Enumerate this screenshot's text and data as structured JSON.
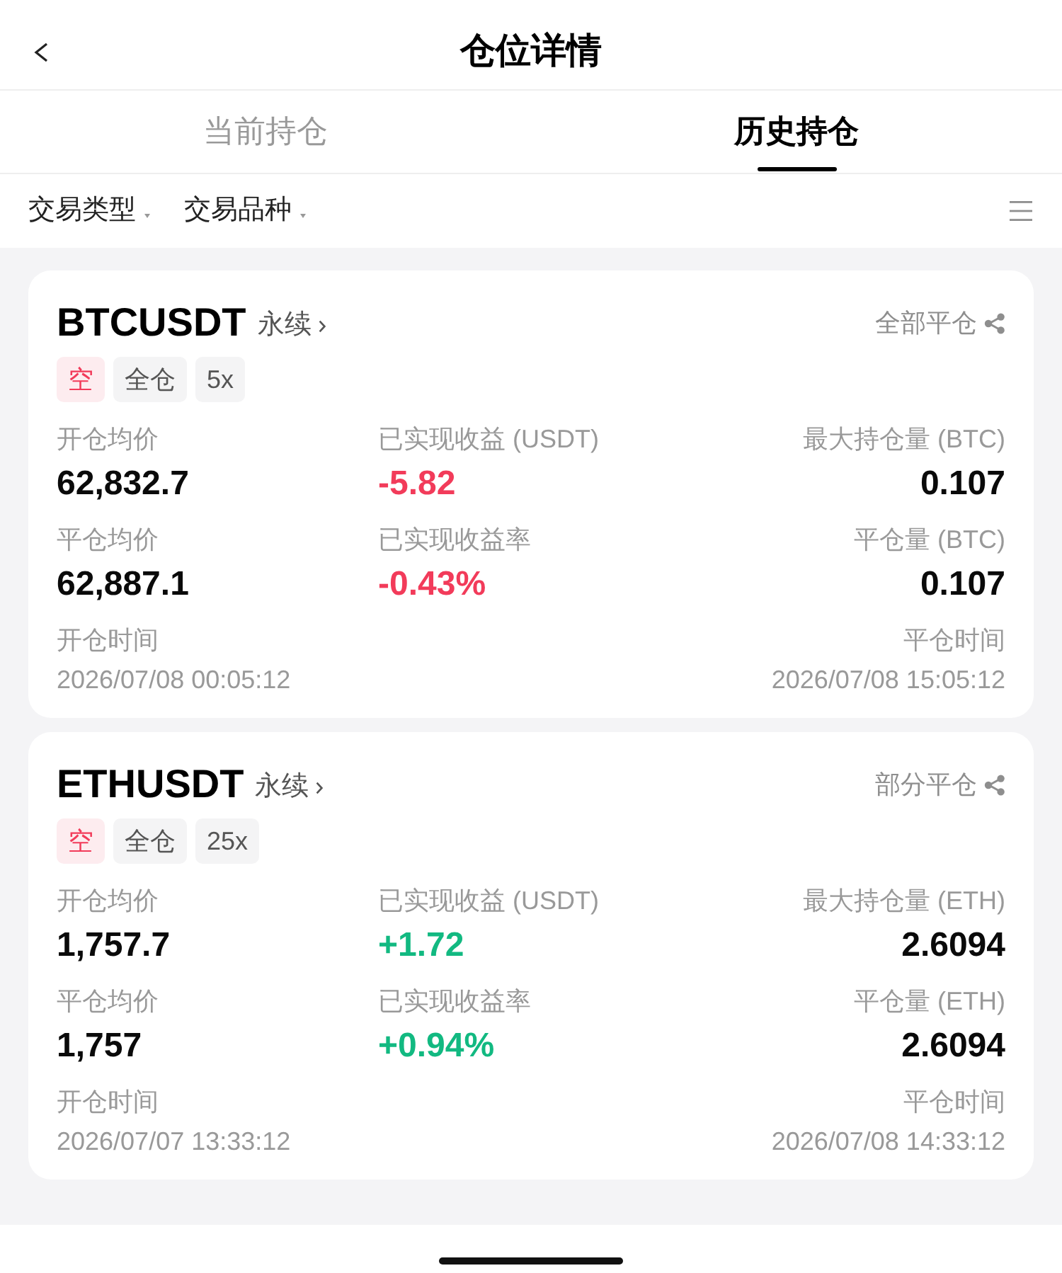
{
  "header": {
    "title": "仓位详情"
  },
  "tabs": [
    {
      "label": "当前持仓",
      "selected": false
    },
    {
      "label": "历史持仓",
      "selected": true
    }
  ],
  "filters": [
    {
      "label": "交易类型"
    },
    {
      "label": "交易品种"
    }
  ],
  "positions": [
    {
      "symbol": "BTCUSDT",
      "contract": "永续",
      "close_status": "全部平仓",
      "tags": [
        {
          "label": "空",
          "kind": "side"
        },
        {
          "label": "全仓",
          "kind": "plain"
        },
        {
          "label": "5x",
          "kind": "plain"
        }
      ],
      "stats": [
        {
          "label": "开仓均价",
          "value": "62,832.7",
          "color": "#0a0a0a"
        },
        {
          "label": "已实现收益 (USDT)",
          "value": "-5.82",
          "color": "#f23b5a"
        },
        {
          "label": "最大持仓量 (BTC)",
          "value": "0.107",
          "color": "#0a0a0a"
        },
        {
          "label": "平仓均价",
          "value": "62,887.1",
          "color": "#0a0a0a"
        },
        {
          "label": "已实现收益率",
          "value": "-0.43%",
          "color": "#f23b5a"
        },
        {
          "label": "平仓量 (BTC)",
          "value": "0.107",
          "color": "#0a0a0a"
        }
      ],
      "times": [
        {
          "label": "开仓时间",
          "value": "2026/07/08 00:05:12"
        },
        {
          "label": "平仓时间",
          "value": "2026/07/08 15:05:12"
        }
      ]
    },
    {
      "symbol": "ETHUSDT",
      "contract": "永续",
      "close_status": "部分平仓",
      "tags": [
        {
          "label": "空",
          "kind": "side"
        },
        {
          "label": "全仓",
          "kind": "plain"
        },
        {
          "label": "25x",
          "kind": "plain"
        }
      ],
      "stats": [
        {
          "label": "开仓均价",
          "value": "1,757.7",
          "color": "#0a0a0a"
        },
        {
          "label": "已实现收益 (USDT)",
          "value": "+1.72",
          "color": "#12b981"
        },
        {
          "label": "最大持仓量 (ETH)",
          "value": "2.6094",
          "color": "#0a0a0a"
        },
        {
          "label": "平仓均价",
          "value": "1,757",
          "color": "#0a0a0a"
        },
        {
          "label": "已实现收益率",
          "value": "+0.94%",
          "color": "#12b981"
        },
        {
          "label": "平仓量 (ETH)",
          "value": "2.6094",
          "color": "#0a0a0a"
        }
      ],
      "times": [
        {
          "label": "开仓时间",
          "value": "2026/07/07 13:33:12"
        },
        {
          "label": "平仓时间",
          "value": "2026/07/08 14:33:12"
        }
      ]
    }
  ]
}
